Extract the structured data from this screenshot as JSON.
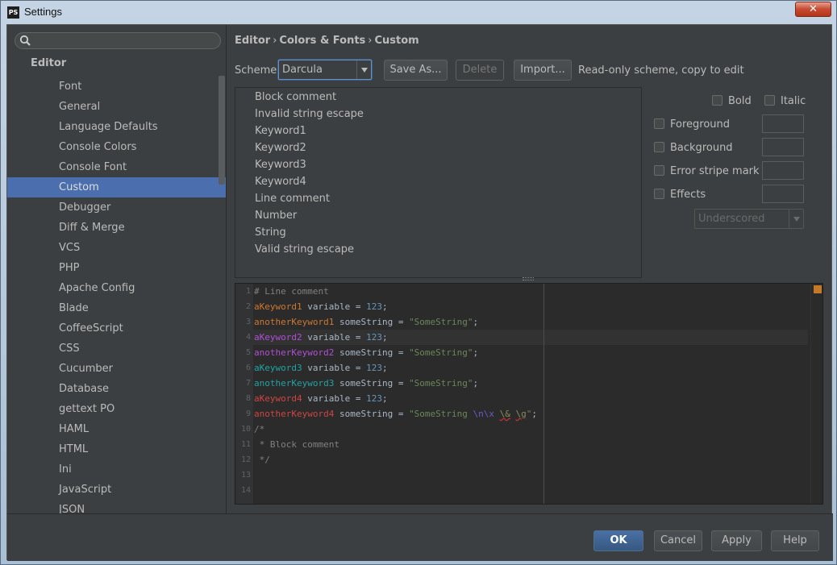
{
  "window": {
    "app_icon": "PS",
    "title": "Settings",
    "close_glyph": "✕"
  },
  "sidebar": {
    "search": {
      "value": "",
      "placeholder": ""
    },
    "root_label": "Editor",
    "items": [
      {
        "label": "Font"
      },
      {
        "label": "General"
      },
      {
        "label": "Language Defaults"
      },
      {
        "label": "Console Colors"
      },
      {
        "label": "Console Font"
      },
      {
        "label": "Custom",
        "selected": true
      },
      {
        "label": "Debugger"
      },
      {
        "label": "Diff & Merge"
      },
      {
        "label": "VCS"
      },
      {
        "label": "PHP"
      },
      {
        "label": "Apache Config"
      },
      {
        "label": "Blade"
      },
      {
        "label": "CoffeeScript"
      },
      {
        "label": "CSS"
      },
      {
        "label": "Cucumber"
      },
      {
        "label": "Database"
      },
      {
        "label": "gettext PO"
      },
      {
        "label": "HAML"
      },
      {
        "label": "HTML"
      },
      {
        "label": "Ini"
      },
      {
        "label": "JavaScript"
      },
      {
        "label": "JSON"
      }
    ]
  },
  "breadcrumb": {
    "part1": "Editor",
    "part2": "Colors & Fonts",
    "part3": "Custom",
    "separator": "›"
  },
  "scheme": {
    "label": "Scheme:",
    "selected": "Darcula",
    "save_as": "Save As...",
    "delete": "Delete",
    "import": "Import...",
    "note": "Read-only scheme, copy to edit"
  },
  "elements": [
    "Block comment",
    "Invalid string escape",
    "Keyword1",
    "Keyword2",
    "Keyword3",
    "Keyword4",
    "Line comment",
    "Number",
    "String",
    "Valid string escape"
  ],
  "attributes": {
    "bold": "Bold",
    "italic": "Italic",
    "foreground": "Foreground",
    "background": "Background",
    "error_stripe": "Error stripe mark",
    "effects": "Effects",
    "effect_type": "Underscored"
  },
  "preview": {
    "line_numbers": [
      "1",
      "2",
      "3",
      "4",
      "5",
      "6",
      "7",
      "8",
      "9",
      "10",
      "11",
      "12",
      "13",
      "14"
    ],
    "line1": "# Line comment",
    "l2_kw": "aKeyword1",
    "l2_rest": " variable = ",
    "l2_num": "123",
    "l2_end": ";",
    "l3_kw": "anotherKeyword1",
    "l3_rest": " someString = ",
    "l3_str": "\"SomeString\"",
    "l3_end": ";",
    "l4_kw": "aKeyword2",
    "l4_rest": " variable = ",
    "l4_num": "123",
    "l4_end": ";",
    "l5_kw": "anotherKeyword2",
    "l5_rest": " someString = ",
    "l5_str": "\"SomeString\"",
    "l5_end": ";",
    "l6_kw": "aKeyword3",
    "l6_rest": " variable = ",
    "l6_num": "123",
    "l6_end": ";",
    "l7_kw": "anotherKeyword3",
    "l7_rest": " someString = ",
    "l7_str": "\"SomeString\"",
    "l7_end": ";",
    "l8_kw": "aKeyword4",
    "l8_rest": " variable = ",
    "l8_num": "123",
    "l8_end": ";",
    "l9_kw": "anotherKeyword4",
    "l9_rest": " someString = ",
    "l9_str1": "\"SomeString ",
    "l9_esc": "\\n\\x",
    "l9_sp": " ",
    "l9_inv1": "\\&",
    "l9_sp2": " ",
    "l9_inv2": "\\g",
    "l9_str2": "\"",
    "l9_end": ";",
    "line10": "/*",
    "line11": " * Block comment",
    "line12": " */"
  },
  "footer": {
    "ok": "OK",
    "cancel": "Cancel",
    "apply": "Apply",
    "help": "Help"
  }
}
